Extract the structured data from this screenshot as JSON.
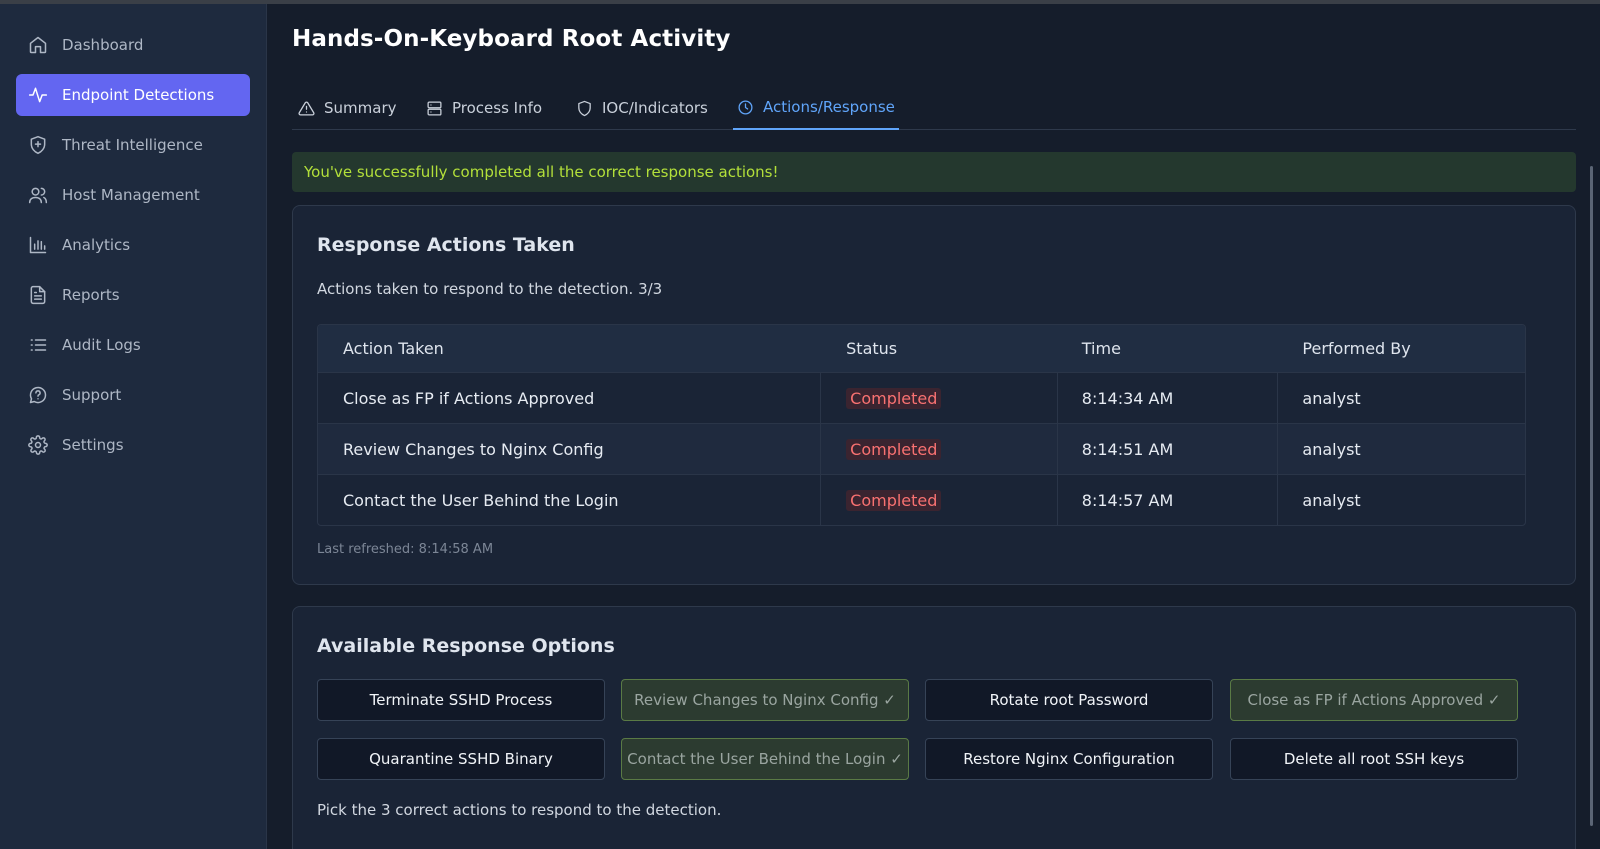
{
  "sidebar": {
    "items": [
      {
        "label": "Dashboard",
        "icon": "home-icon",
        "active": false
      },
      {
        "label": "Endpoint Detections",
        "icon": "activity-icon",
        "active": true
      },
      {
        "label": "Threat Intelligence",
        "icon": "shield-plus-icon",
        "active": false
      },
      {
        "label": "Host Management",
        "icon": "users-icon",
        "active": false
      },
      {
        "label": "Analytics",
        "icon": "bar-chart-icon",
        "active": false
      },
      {
        "label": "Reports",
        "icon": "file-text-icon",
        "active": false
      },
      {
        "label": "Audit Logs",
        "icon": "list-icon",
        "active": false
      },
      {
        "label": "Support",
        "icon": "help-chat-icon",
        "active": false
      },
      {
        "label": "Settings",
        "icon": "gear-icon",
        "active": false
      }
    ]
  },
  "header": {
    "title": "Hands-On-Keyboard Root Activity"
  },
  "tabs": [
    {
      "label": "Summary",
      "icon": "alert-triangle-icon"
    },
    {
      "label": "Process Info",
      "icon": "server-icon"
    },
    {
      "label": "IOC/Indicators",
      "icon": "shield-icon"
    },
    {
      "label": "Actions/Response",
      "icon": "clock-icon",
      "active": true
    }
  ],
  "success_message": "You've successfully completed all the correct response actions!",
  "actions_taken": {
    "title": "Response Actions Taken",
    "description": "Actions taken to respond to the detection. 3/3",
    "columns": [
      "Action Taken",
      "Status",
      "Time",
      "Performed By"
    ],
    "rows": [
      {
        "action": "Close as FP if Actions Approved",
        "status": "Completed",
        "time": "8:14:34 AM",
        "by": "analyst"
      },
      {
        "action": "Review Changes to Nginx Config",
        "status": "Completed",
        "time": "8:14:51 AM",
        "by": "analyst"
      },
      {
        "action": "Contact the User Behind the Login",
        "status": "Completed",
        "time": "8:14:57 AM",
        "by": "analyst"
      }
    ],
    "last_refreshed": "Last refreshed: 8:14:58 AM"
  },
  "available_options": {
    "title": "Available Response Options",
    "options": [
      {
        "label": "Terminate SSHD Process",
        "done": false
      },
      {
        "label": "Review Changes to Nginx Config ✓",
        "done": true
      },
      {
        "label": "Rotate root Password",
        "done": false
      },
      {
        "label": "Close as FP if Actions Approved ✓",
        "done": true
      },
      {
        "label": "Quarantine SSHD Binary",
        "done": false
      },
      {
        "label": "Contact the User Behind the Login ✓",
        "done": true
      },
      {
        "label": "Restore Nginx Configuration",
        "done": false
      },
      {
        "label": "Delete all root SSH keys",
        "done": false
      }
    ],
    "instruction": "Pick the 3 correct actions to respond to the detection."
  },
  "colors": {
    "accent": "#6366f1",
    "tab_active": "#60a5fa",
    "success_text": "#b3e03a",
    "status_completed": "#f87171"
  }
}
